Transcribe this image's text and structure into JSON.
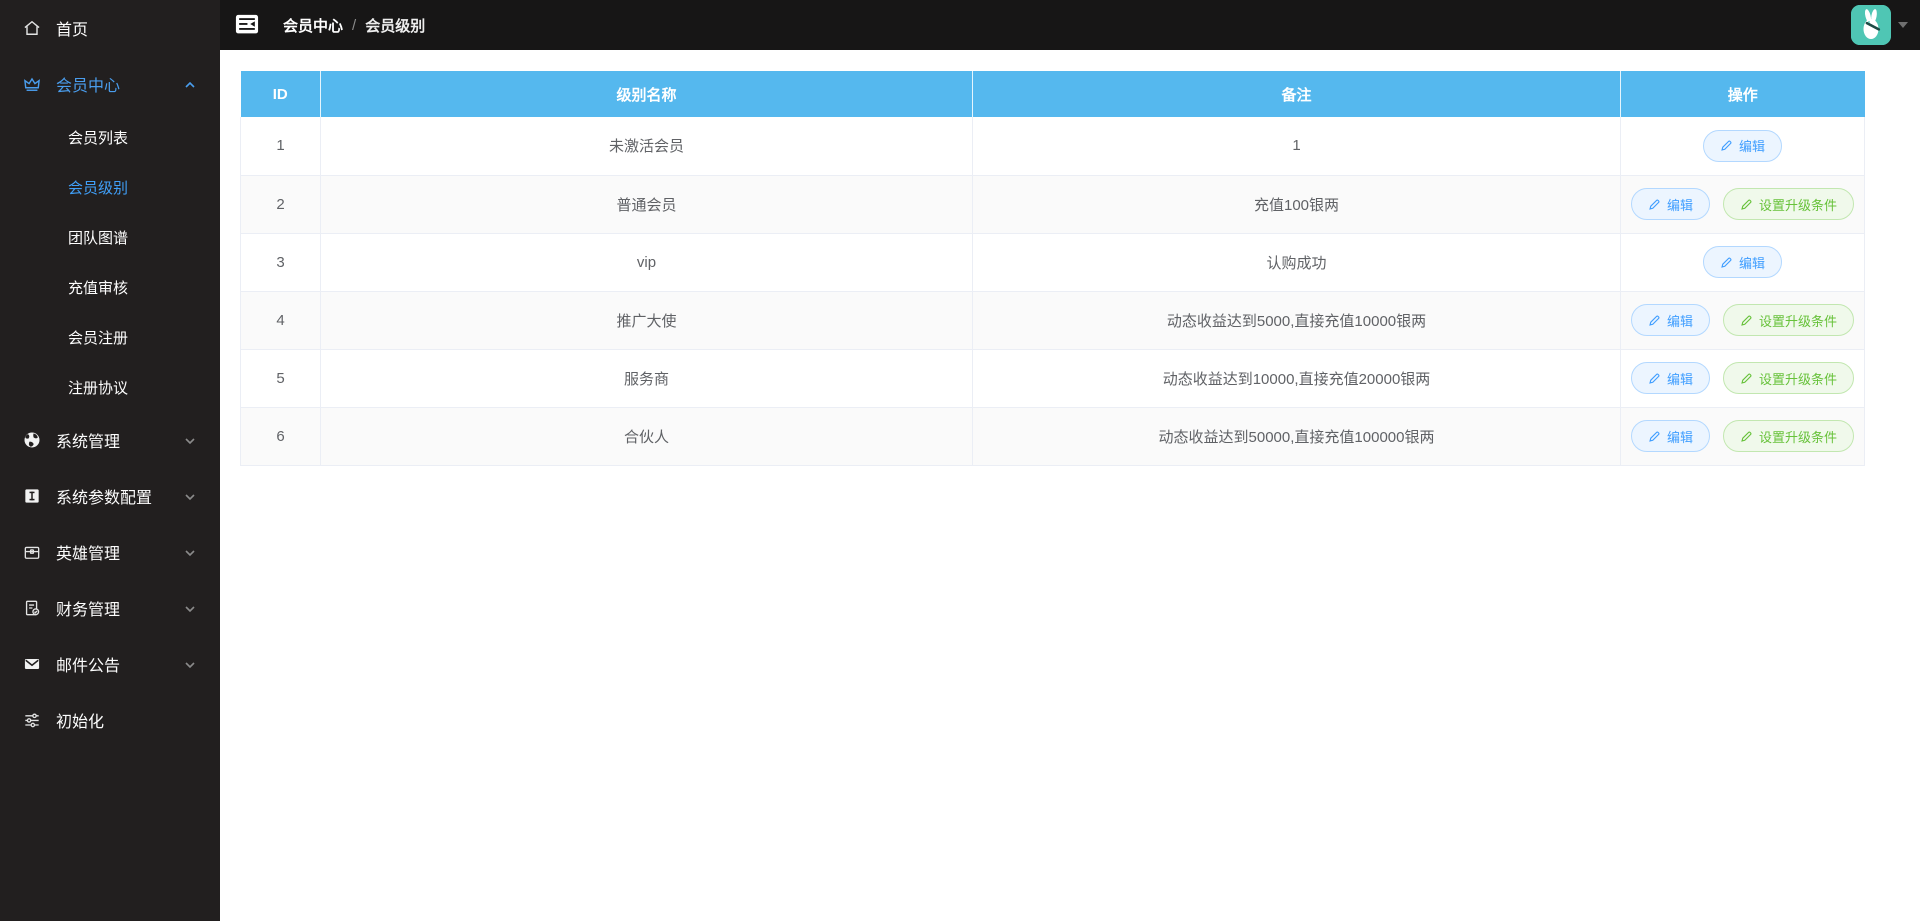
{
  "sidebar": {
    "items": [
      {
        "label": "首页",
        "icon": "home-icon"
      },
      {
        "label": "会员中心",
        "icon": "crown-icon",
        "expanded": true,
        "active": true,
        "children": [
          {
            "label": "会员列表",
            "active": false
          },
          {
            "label": "会员级别",
            "active": true
          },
          {
            "label": "团队图谱",
            "active": false
          },
          {
            "label": "充值审核",
            "active": false
          },
          {
            "label": "会员注册",
            "active": false
          },
          {
            "label": "注册协议",
            "active": false
          }
        ]
      },
      {
        "label": "系统管理",
        "icon": "globe-icon",
        "expanded": false
      },
      {
        "label": "系统参数配置",
        "icon": "info-square-icon",
        "expanded": false
      },
      {
        "label": "英雄管理",
        "icon": "chest-icon",
        "expanded": false
      },
      {
        "label": "财务管理",
        "icon": "finance-doc-icon",
        "expanded": false
      },
      {
        "label": "邮件公告",
        "icon": "mail-icon",
        "expanded": false
      },
      {
        "label": "初始化",
        "icon": "sliders-icon"
      }
    ]
  },
  "header": {
    "breadcrumb": [
      "会员中心",
      "会员级别"
    ],
    "separator": "/"
  },
  "table": {
    "columns": [
      "ID",
      "级别名称",
      "备注",
      "操作"
    ],
    "edit_label": "编辑",
    "upgrade_label": "设置升级条件",
    "rows": [
      {
        "id": "1",
        "name": "未激活会员",
        "remark": "1"
      },
      {
        "id": "2",
        "name": "普通会员",
        "remark": "充值100银两"
      },
      {
        "id": "3",
        "name": "vip",
        "remark": "认购成功"
      },
      {
        "id": "4",
        "name": "推广大使",
        "remark": "动态收益达到5000,直接充值10000银两"
      },
      {
        "id": "5",
        "name": "服务商",
        "remark": "动态收益达到10000,直接充值20000银两"
      },
      {
        "id": "6",
        "name": "合伙人",
        "remark": "动态收益达到50000,直接充值100000银两"
      }
    ]
  },
  "colors": {
    "sidebar_bg": "#221f1f",
    "topbar_bg": "#171616",
    "active_blue": "#409ff8",
    "table_header_bg": "#55b8ee",
    "stripe": "#fafafa",
    "edit_btn_text": "#409eff",
    "upgrade_btn_text": "#67c23a",
    "avatar_bg": "#4fc6b4"
  }
}
